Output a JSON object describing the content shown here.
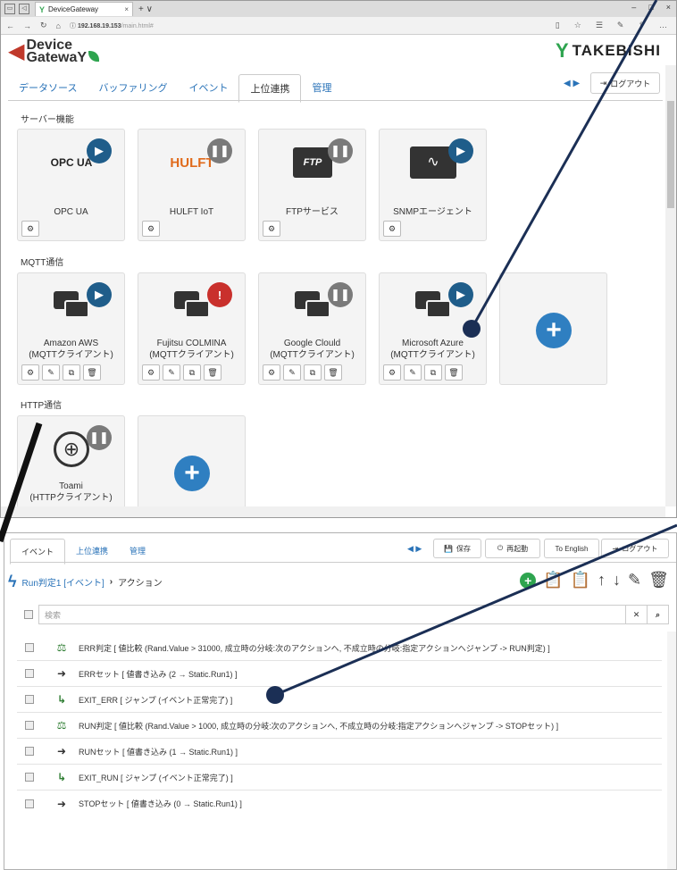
{
  "browser": {
    "tab_title": "DeviceGateway",
    "url_host": "192.168.19.153",
    "url_path": "/main.html#"
  },
  "app": {
    "logo_line1": "Device",
    "logo_line2": "GatewaY",
    "brand": "TAKEBISHI",
    "nav": [
      "データソース",
      "バッファリング",
      "イベント",
      "上位連携",
      "管理"
    ],
    "nav_active_index": 3,
    "logout_label": "ログアウト"
  },
  "sections": {
    "server": "サーバー機能",
    "mqtt": "MQTT通信",
    "http": "HTTP通信"
  },
  "server_cards": [
    {
      "label": "OPC UA",
      "status": "running",
      "logo": "OPC UA"
    },
    {
      "label": "HULFT IoT",
      "status": "paused",
      "logo": "HULFT"
    },
    {
      "label": "FTPサービス",
      "status": "paused",
      "logo": "FTP"
    },
    {
      "label": "SNMPエージェント",
      "status": "running",
      "logo": ""
    }
  ],
  "mqtt_cards": [
    {
      "line1": "Amazon AWS",
      "line2": "(MQTTクライアント)",
      "status": "running"
    },
    {
      "line1": "Fujitsu COLMINA",
      "line2": "(MQTTクライアント)",
      "status": "error"
    },
    {
      "line1": "Google Clould",
      "line2": "(MQTTクライアント)",
      "status": "paused"
    },
    {
      "line1": "Microsoft Azure",
      "line2": "(MQTTクライアント)",
      "status": "running"
    }
  ],
  "http_cards": [
    {
      "line1": "Toami",
      "line2": "(HTTPクライアント)",
      "status": "paused"
    }
  ],
  "event_screen": {
    "nav": [
      "イベント",
      "上位連携",
      "管理"
    ],
    "nav_active_index": 0,
    "buttons": {
      "save": "保存",
      "restart": "再起動",
      "english": "To English",
      "logout": "ログアウト"
    },
    "breadcrumb": {
      "event_name": "Run判定1",
      "event_tag": "[イベント]",
      "current": "アクション"
    },
    "search_placeholder": "検索",
    "actions": [
      {
        "icon": "compare-icon",
        "text": "ERR判定 [ 値比較 (Rand.Value > 31000, 成立時の分岐:次のアクションへ, 不成立時の分岐:指定アクションへジャンプ -> RUN判定) ]"
      },
      {
        "icon": "write-icon",
        "text": "ERRセット [ 値書き込み (2 → Static.Run1) ]"
      },
      {
        "icon": "jump-icon",
        "text": "EXIT_ERR [ ジャンプ (イベント正常完了) ]"
      },
      {
        "icon": "compare-icon",
        "text": "RUN判定 [ 値比較 (Rand.Value > 1000, 成立時の分岐:次のアクションへ, 不成立時の分岐:指定アクションへジャンプ -> STOPセット) ]"
      },
      {
        "icon": "write-icon",
        "text": "RUNセット [ 値書き込み (1 → Static.Run1) ]"
      },
      {
        "icon": "jump-icon",
        "text": "EXIT_RUN [ ジャンプ (イベント正常完了) ]"
      },
      {
        "icon": "write-icon",
        "text": "STOPセット [ 値書き込み (0 → Static.Run1) ]"
      }
    ]
  },
  "colors": {
    "link": "#2a73b8",
    "running_badge": "#1f5d8a",
    "paused_badge": "#7a7a7a",
    "error_badge": "#c9302c",
    "add_button": "#2f7fc1",
    "callout_marker": "#1b2f55"
  }
}
